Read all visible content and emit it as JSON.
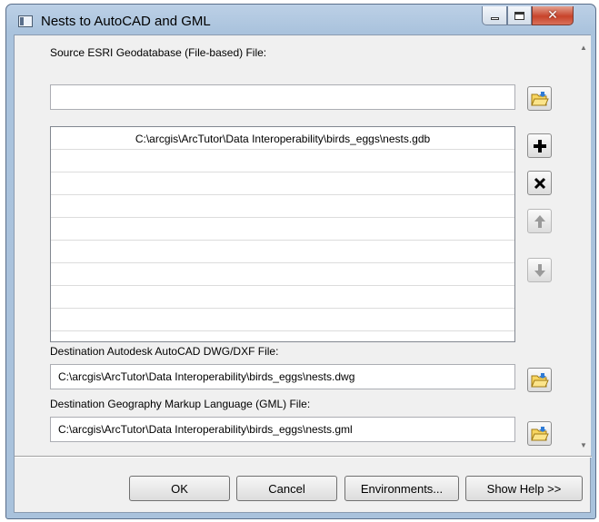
{
  "window": {
    "title": "Nests to AutoCAD and GML"
  },
  "source": {
    "label": "Source ESRI Geodatabase (File-based) File:",
    "value": "",
    "list": [
      "C:\\arcgis\\ArcTutor\\Data Interoperability\\birds_eggs\\nests.gdb",
      "",
      "",
      "",
      "",
      "",
      "",
      "",
      ""
    ]
  },
  "dest_dwg": {
    "label": "Destination Autodesk AutoCAD DWG/DXF File:",
    "value": "C:\\arcgis\\ArcTutor\\Data Interoperability\\birds_eggs\\nests.dwg"
  },
  "dest_gml": {
    "label": "Destination Geography Markup Language (GML) File:",
    "value": "C:\\arcgis\\ArcTutor\\Data Interoperability\\birds_eggs\\nests.gml"
  },
  "buttons": {
    "ok": "OK",
    "cancel": "Cancel",
    "environments": "Environments...",
    "show_help": "Show Help >>"
  },
  "icons": {
    "browse": "open-folder-icon",
    "add": "plus-icon",
    "remove": "x-icon",
    "move_up": "arrow-up-icon",
    "move_down": "arrow-down-icon"
  }
}
